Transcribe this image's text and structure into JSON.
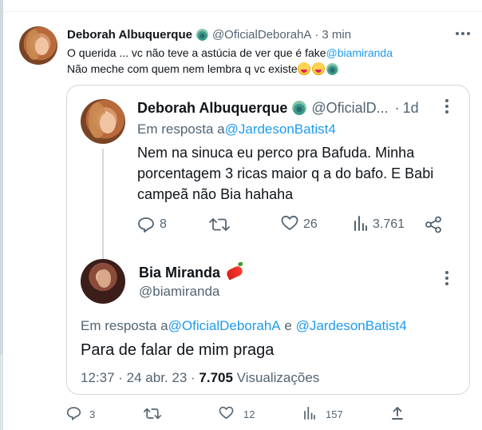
{
  "tweet": {
    "display_name": "Deborah Albuquerque",
    "handle": "@OficialDeborahA",
    "separator": "·",
    "time": "3 min",
    "line1_text": "O querida ... vc não teve a astúcia de ver que é fake ",
    "line1_mention": "@biamiranda",
    "line2_text": "Não meche com quem nem lembra q vc existe "
  },
  "quoted_tweet": {
    "display_name": "Deborah Albuquerque",
    "handle": "@OficialD...",
    "separator": "·",
    "time": "1d",
    "reply_prefix": "Em resposta a ",
    "reply_to": "@JardesonBatist4",
    "body_line1": "Nem na sinuca eu perco pra Bafuda. Minha",
    "body_line2": "porcentagem 3 ricas maior q a do bafo. E Babi",
    "body_line3": "campeã não Bia hahaha",
    "replies": "8",
    "likes": "26",
    "views": "3.761"
  },
  "reply_tweet": {
    "display_name": "Bia Miranda",
    "handle": "@biamiranda",
    "reply_prefix": "Em resposta a ",
    "reply_to_1": "@OficialDeborahA",
    "reply_conj": " e ",
    "reply_to_2": "@JardesonBatist4",
    "body": "Para de falar de mim praga",
    "timestamp": "12:37 · 24 abr. 23 · ",
    "views_count": "7.705",
    "views_label": " Visualizações"
  },
  "actions": {
    "replies": "3",
    "likes": "12",
    "views": "157"
  },
  "icons": [
    "more-icon",
    "reply-icon",
    "retweet-icon",
    "like-icon",
    "views-icon",
    "share-icon",
    "peacock-emoji",
    "laughing-emoji",
    "chili-emoji"
  ],
  "colors": {
    "link": "#1d9bf0",
    "muted": "#536471",
    "text": "#0f1419",
    "border": "#cfd9de"
  }
}
